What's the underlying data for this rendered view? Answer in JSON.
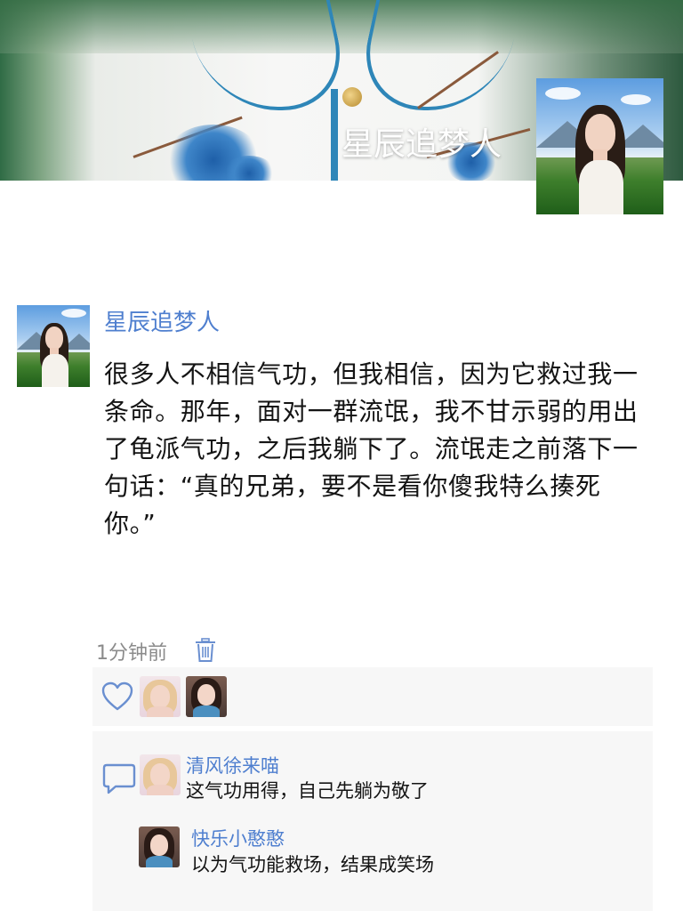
{
  "profile": {
    "cover_title": "星辰追梦人"
  },
  "post": {
    "author": "星辰追梦人",
    "content": "很多人不相信气功，但我相信，因为它救过我一条命。那年，面对一群流氓，我不甘示弱的用出了龟派气功，之后我躺下了。流氓走之前落下一句话：“真的兄弟，要不是看你傻我特么揍死你。”",
    "time": "1分钟前"
  },
  "likes": {
    "icon": "heart-icon",
    "users": [
      "liker-1",
      "liker-2"
    ]
  },
  "comments": {
    "icon": "comment-bubble-icon",
    "items": [
      {
        "name": "清风徐来喵",
        "text": "这气功用得，自己先躺为敬了"
      },
      {
        "name": "快乐小憨憨",
        "text": "以为气功能救场，结果成笑场"
      }
    ]
  },
  "colors": {
    "link": "#4f7fcf",
    "panel": "#f7f7f7",
    "text": "#141414",
    "muted": "#8b8b8b"
  }
}
